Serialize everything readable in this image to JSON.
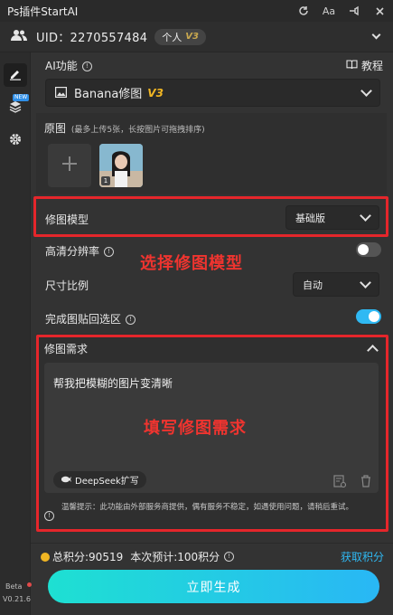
{
  "app": {
    "title": "Ps插件StartAI"
  },
  "user": {
    "uid_text": "UID：2270557484",
    "badge_label": "个人",
    "badge_level": "V3"
  },
  "sidebar": {
    "new_badge": "NEW",
    "beta": "Beta",
    "version": "V0.21.6"
  },
  "ai_function": {
    "label": "AI功能",
    "tutorial": "教程",
    "selected": "Banana修图",
    "selected_level": "V3"
  },
  "original": {
    "label": "原图",
    "hint": "(最多上传5张，长按图片可拖拽排序)",
    "thumb_index": "1"
  },
  "model": {
    "label": "修图模型",
    "value": "基础版"
  },
  "hd": {
    "label": "高清分辨率",
    "enabled": false
  },
  "ratio": {
    "label": "尺寸比例",
    "value": "自动"
  },
  "paste_back": {
    "label": "完成图贴回选区",
    "enabled": true
  },
  "request": {
    "label": "修图需求",
    "text": "帮我把模糊的图片变清晰",
    "deepseek": "DeepSeek扩写"
  },
  "notice": {
    "text": "温馨提示：此功能由外部服务商提供，偶有服务不稳定，如遇使用问题，请稍后重试。"
  },
  "annotations": {
    "model": "选择修图模型",
    "request": "填写修图需求"
  },
  "points": {
    "total": "总积分:90519",
    "estimate": "本次预计:100积分",
    "get_points": "获取积分"
  },
  "generate": {
    "label": "立即生成"
  },
  "colors": {
    "accent": "#2fb9f3",
    "highlight": "#e5262b",
    "gold": "#f1b623",
    "level": "#c9a84f"
  }
}
